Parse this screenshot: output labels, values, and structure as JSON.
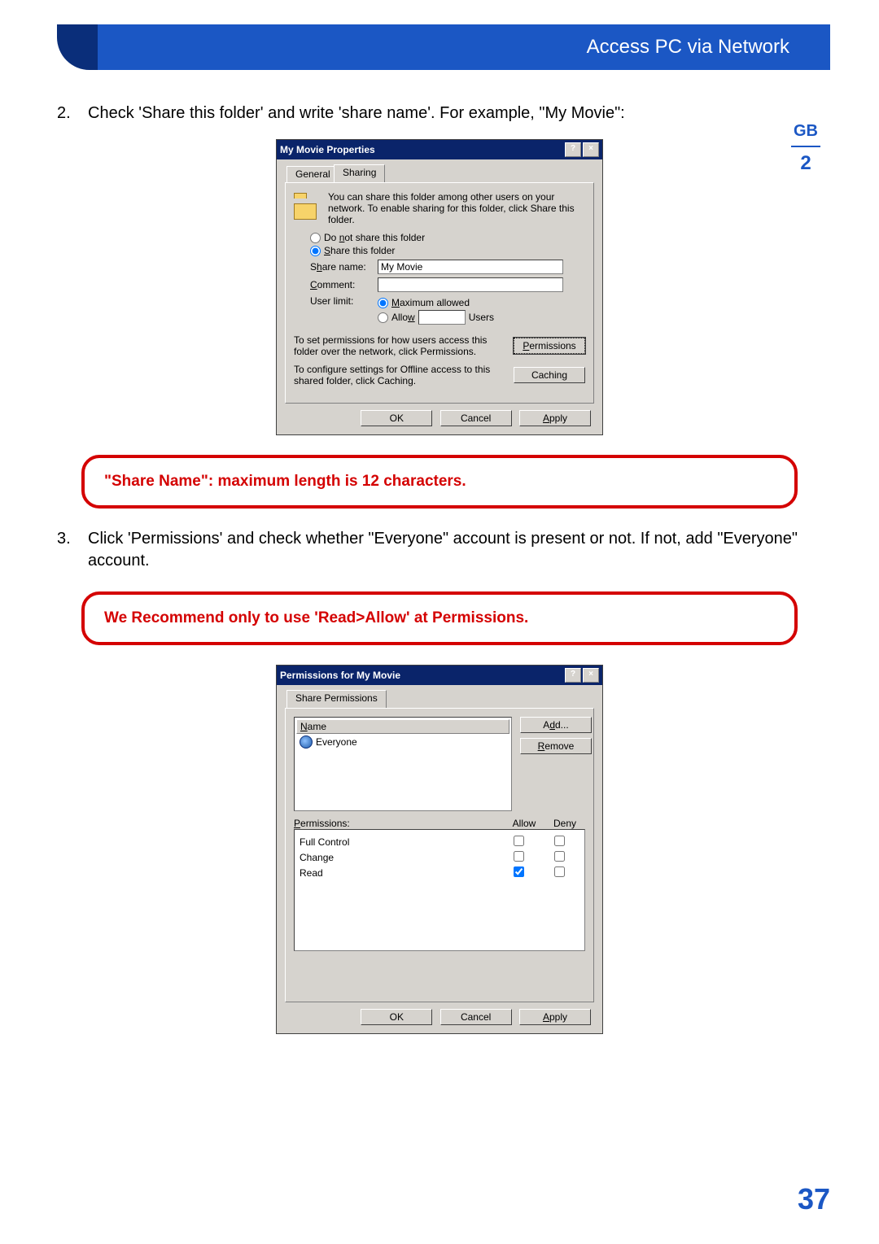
{
  "header": {
    "title": "Access PC via Network"
  },
  "side_tab": {
    "lang": "GB",
    "chapter": "2"
  },
  "steps": {
    "s2": {
      "num": "2.",
      "text": "Check 'Share this folder' and write 'share name'. For example, \"My Movie\":"
    },
    "s3": {
      "num": "3.",
      "text": "Click 'Permissions' and check whether \"Everyone\" account is present or not. If not, add \"Everyone\" account."
    }
  },
  "callouts": {
    "c1": "\"Share Name\": maximum length is 12 characters.",
    "c2": "We Recommend only to use 'Read>Allow' at Permissions."
  },
  "dlg1": {
    "title": "My Movie Properties",
    "tabs": {
      "general": "General",
      "sharing": "Sharing"
    },
    "info": "You can share this folder among other users on your network.  To enable sharing for this folder, click Share this folder.",
    "opt_noshare": "Do not share this folder",
    "opt_share": "Share this folder",
    "row_sharename": "Share name:",
    "val_sharename": "My Movie",
    "row_comment": "Comment:",
    "row_userlimit": "User limit:",
    "opt_max": "Maximum allowed",
    "opt_allow": "Allow",
    "opt_users": "Users",
    "perm_text": "To set permissions for how users access this folder over the network, click Permissions.",
    "perm_btn": "Permissions",
    "cache_text": "To configure settings for Offline access to this shared folder, click Caching.",
    "cache_btn": "Caching",
    "ok": "OK",
    "cancel": "Cancel",
    "apply": "Apply"
  },
  "dlg2": {
    "title": "Permissions for My Movie",
    "tab": "Share Permissions",
    "name_hdr": "Name",
    "add": "Add...",
    "remove": "Remove",
    "everyone": "Everyone",
    "perm_label": "Permissions:",
    "col_allow": "Allow",
    "col_deny": "Deny",
    "perms": [
      {
        "name": "Full Control",
        "allow": false,
        "deny": false
      },
      {
        "name": "Change",
        "allow": false,
        "deny": false
      },
      {
        "name": "Read",
        "allow": true,
        "deny": false
      }
    ],
    "ok": "OK",
    "cancel": "Cancel",
    "apply": "Apply"
  },
  "page_no": "37"
}
